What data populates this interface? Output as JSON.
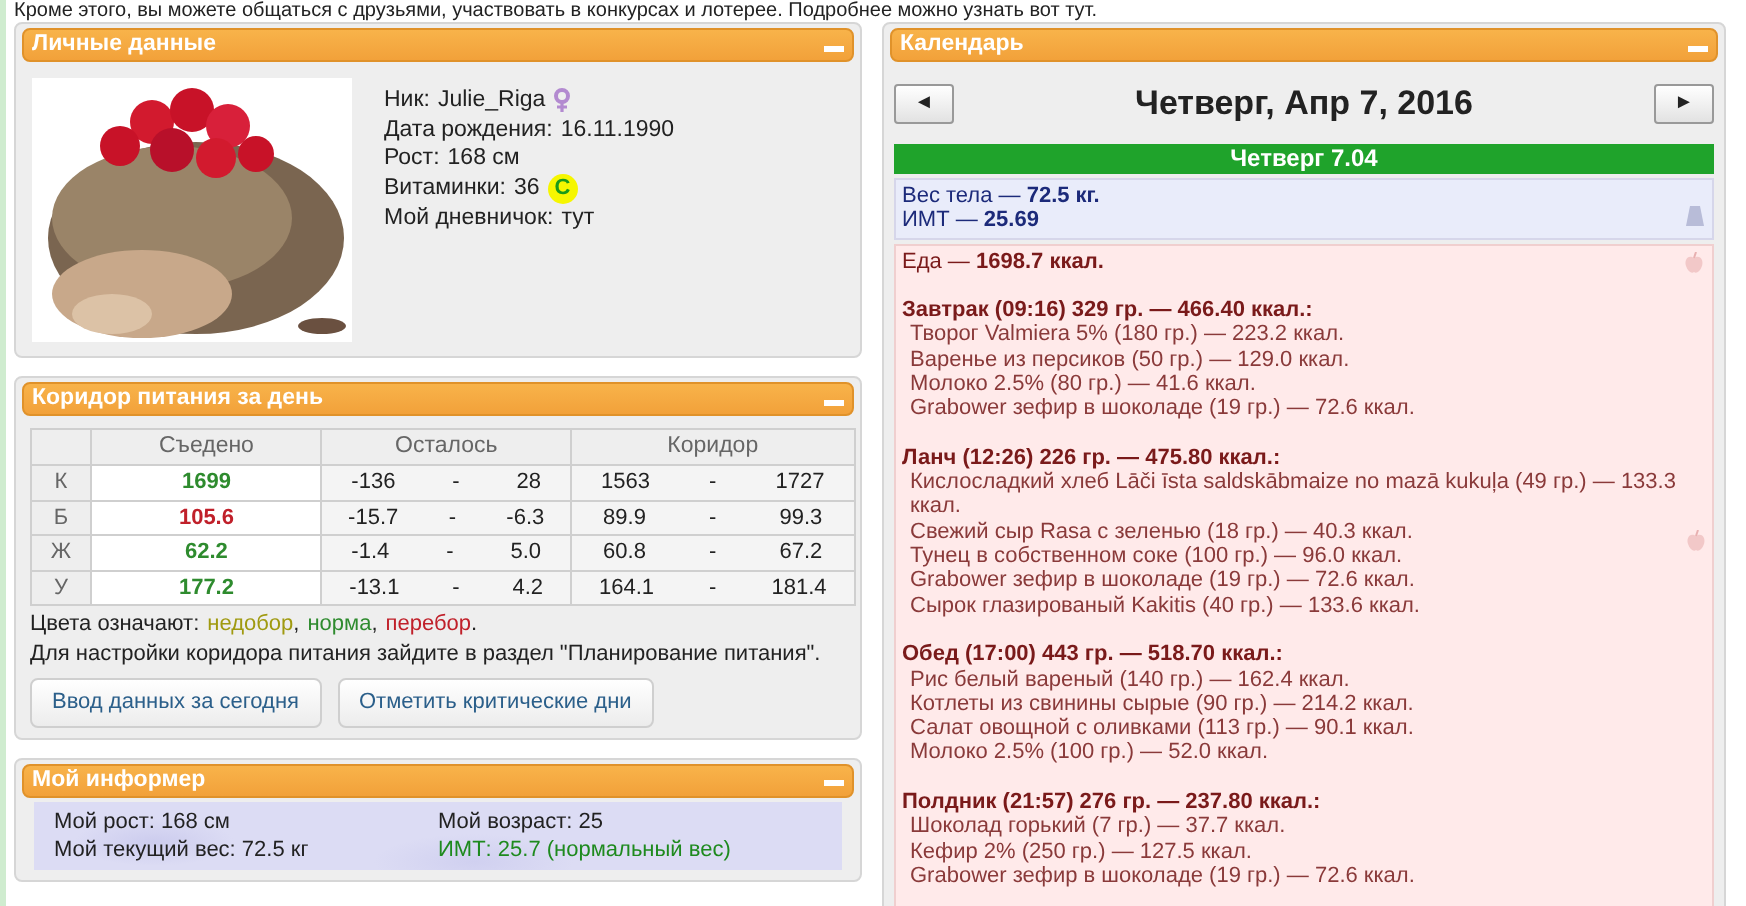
{
  "intro": {
    "text": "Кроме этого, вы можете общаться с друзьями, участвовать в конкурсах и лотерее.",
    "link": "Подробнее можно узнать вот тут."
  },
  "profile": {
    "title": "Личные данные",
    "fields": [
      {
        "kind": "gender",
        "label": "Ник:",
        "value": "Julie_Riga"
      },
      {
        "kind": "text",
        "label": "Дата рождения:",
        "value": "16.11.1990"
      },
      {
        "kind": "text",
        "label": "Рост:",
        "value": "168 см"
      },
      {
        "kind": "badge",
        "label": "Витаминки:",
        "value": "36",
        "badge": "C"
      },
      {
        "kind": "text",
        "label": "Мой дневничок:",
        "value": "тут"
      }
    ]
  },
  "corridor": {
    "title": "Коридор питания за день",
    "columns": [
      "Съедено",
      "Осталось",
      "Коридор"
    ],
    "rows": [
      {
        "nutrient": "К",
        "eaten": "1699",
        "color": "#2e8b2e",
        "left_min": "-136",
        "left_dash": "-",
        "left_max": "28",
        "range_min": "1563",
        "range_dash": "-",
        "range_max": "1727"
      },
      {
        "nutrient": "Б",
        "eaten": "105.6",
        "color": "#c0202a",
        "left_min": "-15.7",
        "left_dash": "-",
        "left_max": "-6.3",
        "range_min": "89.9",
        "range_dash": "-",
        "range_max": "99.3"
      },
      {
        "nutrient": "Ж",
        "eaten": "62.2",
        "color": "#2e8b2e",
        "left_min": "-1.4",
        "left_dash": "-",
        "left_max": "5.0",
        "range_min": "60.8",
        "range_dash": "-",
        "range_max": "67.2"
      },
      {
        "nutrient": "У",
        "eaten": "177.2",
        "color": "#2e8b2e",
        "left_min": "-13.1",
        "left_dash": "-",
        "left_max": "4.2",
        "range_min": "164.1",
        "range_dash": "-",
        "range_max": "181.4"
      }
    ],
    "legend": {
      "label": "Цвета означают:",
      "items": [
        {
          "text": "недобор",
          "color": "#a09a10",
          "after": ","
        },
        {
          "text": "норма",
          "color": "#2e8b2e",
          "after": ","
        },
        {
          "text": "перебор",
          "color": "#c0202a",
          "after": "."
        }
      ]
    },
    "note": "Для настройки коридора питания зайдите в раздел \"Планирование питания\".",
    "buttons": [
      "Ввод данных за сегодня",
      "Отметить критические дни"
    ]
  },
  "informer": {
    "title": "Мой информер",
    "items": [
      {
        "kind": "plain",
        "text": "Мой рост: 168 см"
      },
      {
        "kind": "plain",
        "text": "Мой возраст: 25"
      },
      {
        "kind": "plain",
        "text": "Мой текущий вес: 72.5 кг"
      },
      {
        "kind": "good",
        "text": "ИМТ: 25.7 (нормальный вес)"
      }
    ]
  },
  "calendar": {
    "title": "Календарь",
    "prev": "◄",
    "next": "►",
    "date": "Четверг, Апр 7, 2016",
    "day_header": "Четверг 7.04",
    "weight": [
      "Вес тела — **72.5 кг.**",
      "ИМТ — **25.69**"
    ],
    "food": {
      "total": "Еда — **1698.7 ккал.**",
      "meals": [
        {
          "title": "Завтрак (09:16) 329 гр. — 466.40 ккал.:",
          "marker": false,
          "items": [
            "Творог Valmiera 5% (180 гр.) — 223.2 ккал.",
            "Варенье из персиков (50 гр.) — 129.0 ккал.",
            "Молоко 2.5% (80 гр.) — 41.6 ккал.",
            "Grabower зефир в шоколаде (19 гр.) — 72.6 ккал."
          ]
        },
        {
          "title": "Ланч (12:26) 226 гр. — 475.80 ккал.:",
          "marker": true,
          "items": [
            "Кислосладкий хлеб Lāči īsta saldskābmaize no mazā kukuļa (49 гр.) — 133.3 ккал.",
            "Свежий сыр Rasa с зеленью (18 гр.) — 40.3 ккал.",
            "Тунец в собственном соке (100 гр.) — 96.0 ккал.",
            "Grabower зефир в шоколаде (19 гр.) — 72.6 ккал.",
            "Сырок глазированый Kakitis (40 гр.) — 133.6 ккал."
          ]
        },
        {
          "title": "Обед (17:00) 443 гр. — 518.70 ккал.:",
          "marker": false,
          "items": [
            "Рис белый вареный (140 гр.) — 162.4 ккал.",
            "Котлеты из свинины сырые (90 гр.) — 214.2 ккал.",
            "Салат овощной с оливками (113 гр.) — 90.1 ккал.",
            "Молоко 2.5% (100 гр.) — 52.0 ккал."
          ]
        },
        {
          "title": "Полдник (21:57) 276 гр. — 237.80 ккал.:",
          "marker": false,
          "items": [
            "Шоколад горький (7 гр.) — 37.7 ккал.",
            "Кефир 2% (250 гр.) — 127.5 ккал.",
            "Grabower зефир в шоколаде (19 гр.) — 72.6 ккал."
          ]
        }
      ]
    }
  }
}
